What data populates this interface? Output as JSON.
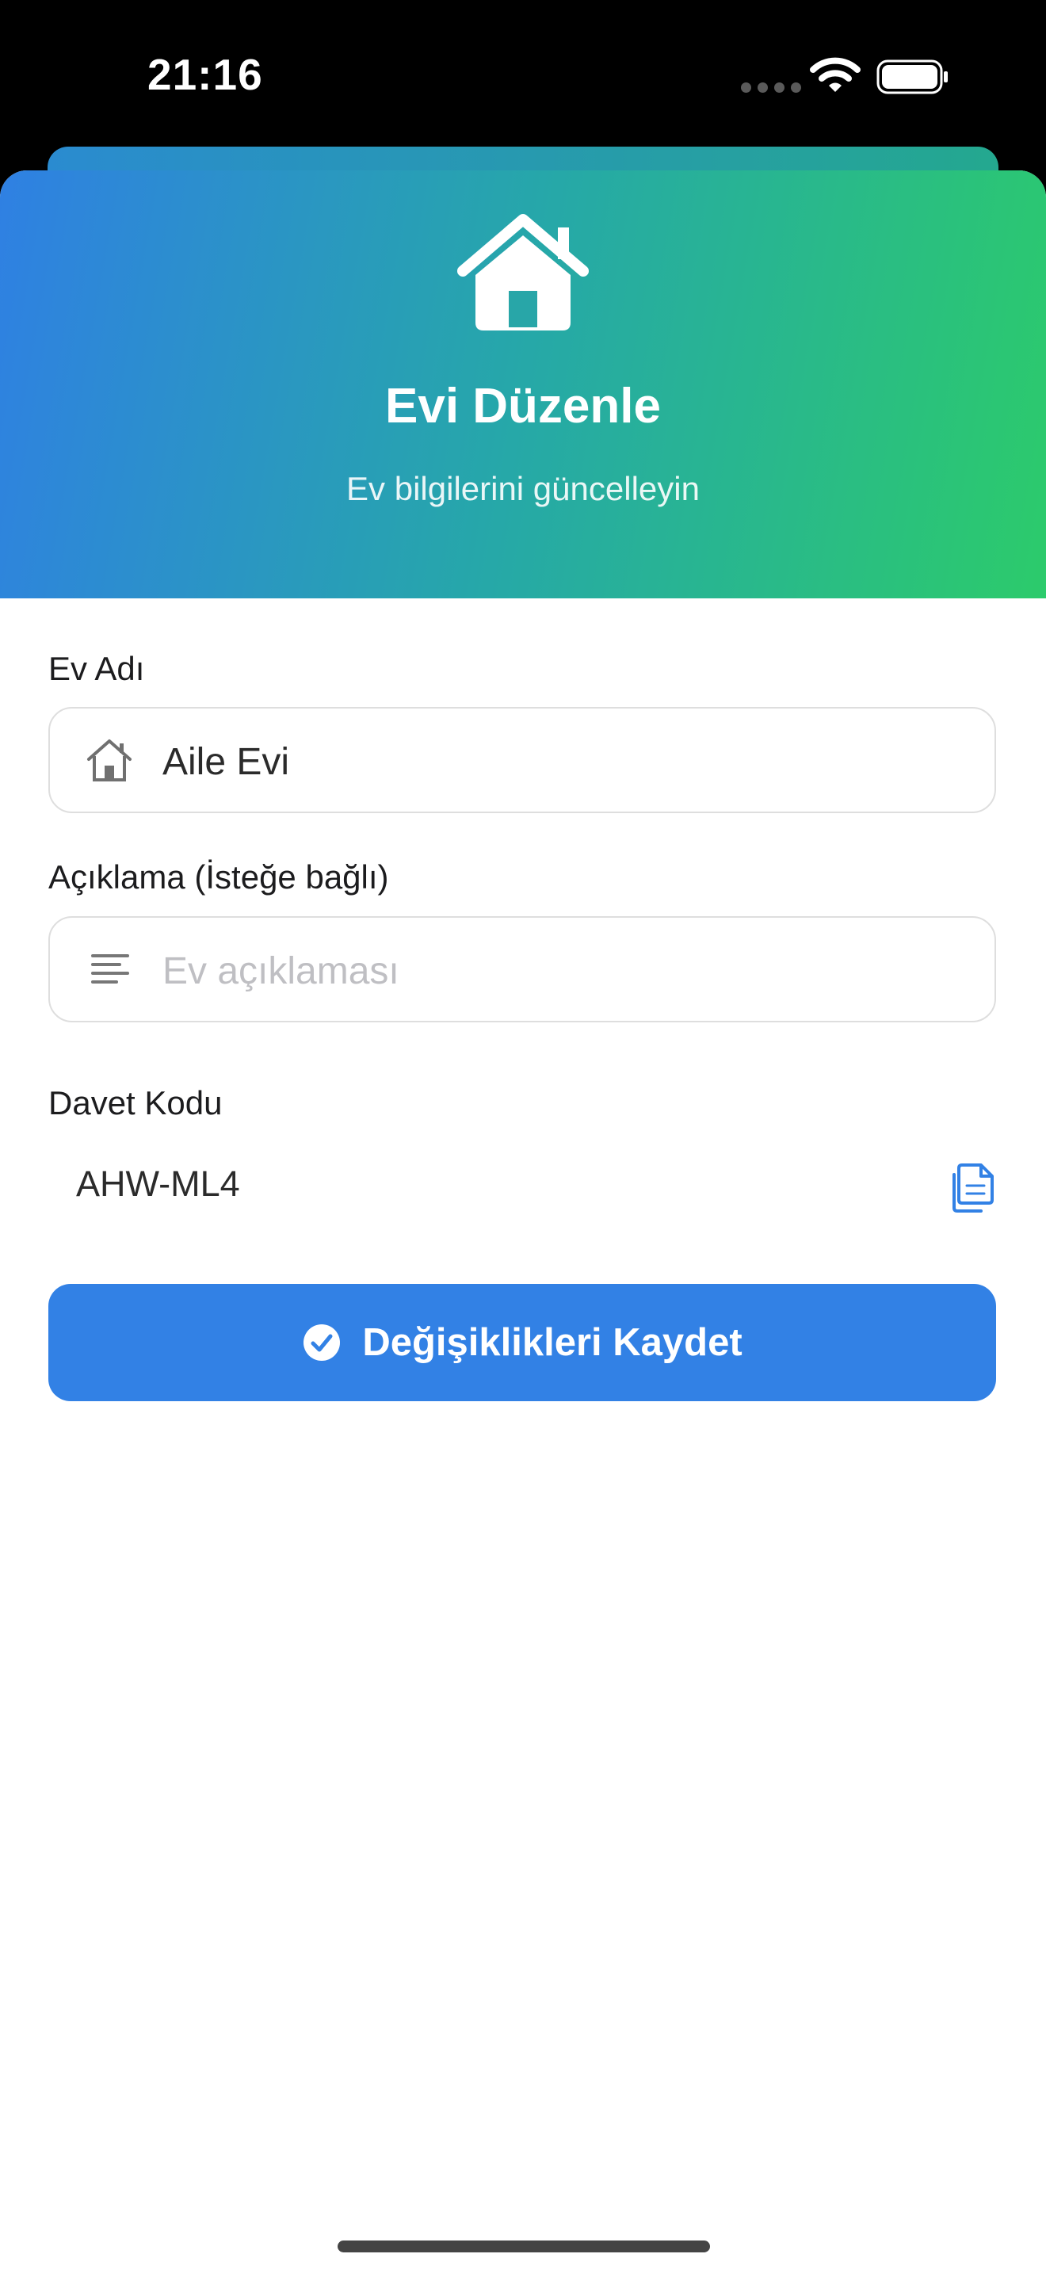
{
  "status_bar": {
    "time": "21:16"
  },
  "header": {
    "title": "Evi Düzenle",
    "subtitle": "Ev bilgilerini güncelleyin",
    "icon": "house-icon",
    "gradient_colors": [
      "#2f80e3",
      "#26a8a8",
      "#2ccb6b"
    ]
  },
  "form": {
    "name_label": "Ev Adı",
    "name_value": "Aile Evi",
    "name_icon": "house-icon",
    "description_label": "Açıklama (İsteğe bağlı)",
    "description_placeholder": "Ev açıklaması",
    "description_icon": "text-lines-icon",
    "invite_label": "Davet Kodu",
    "invite_code": "AHW-ML4",
    "copy_icon": "copy-icon"
  },
  "actions": {
    "save_label": "Değişiklikleri Kaydet",
    "save_icon": "checkmark-circle-icon",
    "accent_color": "#3281e5"
  }
}
